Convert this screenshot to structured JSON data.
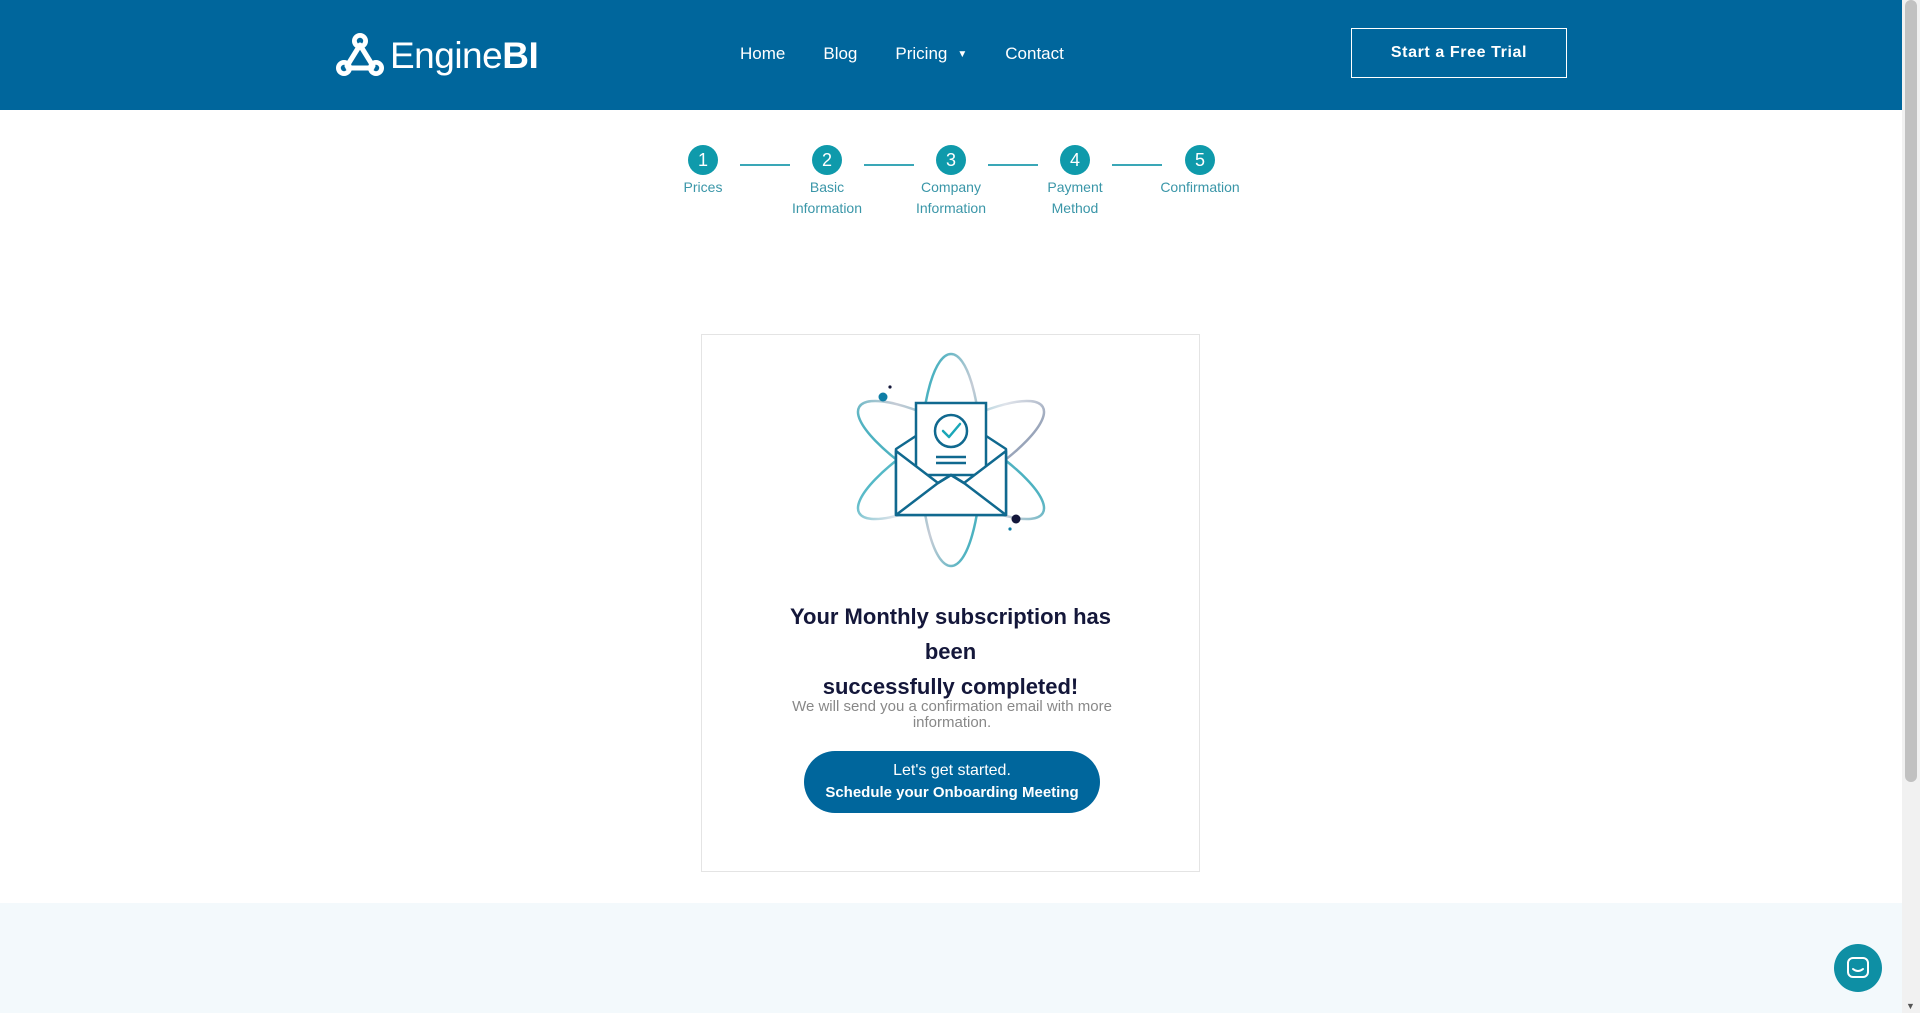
{
  "brand": {
    "name_light": "Engine",
    "name_bold": "BI"
  },
  "nav": {
    "items": [
      {
        "label": "Home"
      },
      {
        "label": "Blog"
      },
      {
        "label": "Pricing"
      },
      {
        "label": "Contact"
      }
    ],
    "pricing_caret": "▼"
  },
  "header": {
    "cta_label": "Start a Free Trial"
  },
  "stepper": {
    "steps": [
      {
        "number": "1",
        "label_line1": "Prices",
        "label_line2": ""
      },
      {
        "number": "2",
        "label_line1": "Basic",
        "label_line2": "Information"
      },
      {
        "number": "3",
        "label_line1": "Company",
        "label_line2": "Information"
      },
      {
        "number": "4",
        "label_line1": "Payment",
        "label_line2": "Method"
      },
      {
        "number": "5",
        "label_line1": "Confirmation",
        "label_line2": ""
      }
    ]
  },
  "confirmation": {
    "title_line1": "Your Monthly subscription has been",
    "title_line2": "successfully completed!",
    "subtitle": "We will send you a confirmation email with more information.",
    "cta_line1": "Let's get started.",
    "cta_line2": "Schedule your Onboarding Meeting"
  },
  "colors": {
    "header_bg": "#00669c",
    "accent_teal": "#0f9aab",
    "title_text": "#14173a",
    "footer_band": "#f3f9fc"
  },
  "icons": [
    "engine-bi-logo-icon",
    "envelope-check-illustration",
    "chat-icon",
    "caret-down-icon"
  ]
}
